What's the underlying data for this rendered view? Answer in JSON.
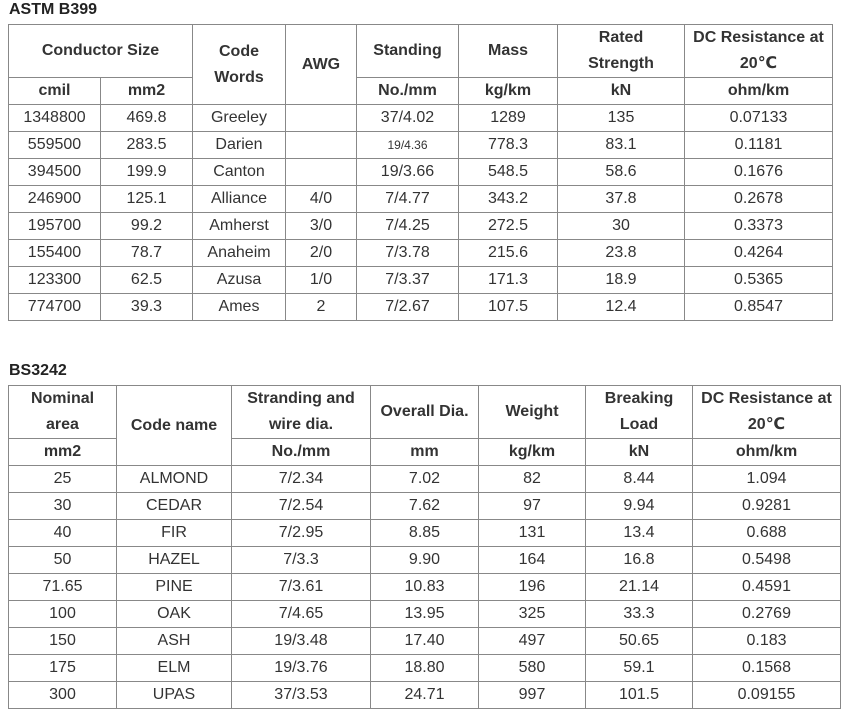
{
  "astm": {
    "title": "ASTM B399",
    "headers": {
      "conductor_size": "Conductor Size",
      "code_words": "Code Words",
      "awg": "AWG",
      "standing": "Standing",
      "mass": "Mass",
      "rated_strength": "Rated Strength",
      "dc_resistance": "DC Resistance at 20℃"
    },
    "units": {
      "cmil": "cmil",
      "mm2": "mm2",
      "standing": "No./mm",
      "mass": "kg/km",
      "rated_strength": "kN",
      "dc_resistance": "ohm/km"
    },
    "rows": [
      {
        "cmil": "1348800",
        "mm2": "469.8",
        "code": "Greeley",
        "awg": "",
        "standing": "37/4.02",
        "mass": "1289",
        "strength": "135",
        "resistance": "0.07133"
      },
      {
        "cmil": "559500",
        "mm2": "283.5",
        "code": "Darien",
        "awg": "",
        "standing": "19/4.36",
        "mass": "778.3",
        "strength": "83.1",
        "resistance": "0.1181"
      },
      {
        "cmil": "394500",
        "mm2": "199.9",
        "code": "Canton",
        "awg": "",
        "standing": "19/3.66",
        "mass": "548.5",
        "strength": "58.6",
        "resistance": "0.1676"
      },
      {
        "cmil": "246900",
        "mm2": "125.1",
        "code": "Alliance",
        "awg": "4/0",
        "standing": "7/4.77",
        "mass": "343.2",
        "strength": "37.8",
        "resistance": "0.2678"
      },
      {
        "cmil": "195700",
        "mm2": "99.2",
        "code": "Amherst",
        "awg": "3/0",
        "standing": "7/4.25",
        "mass": "272.5",
        "strength": "30",
        "resistance": "0.3373"
      },
      {
        "cmil": "155400",
        "mm2": "78.7",
        "code": "Anaheim",
        "awg": "2/0",
        "standing": "7/3.78",
        "mass": "215.6",
        "strength": "23.8",
        "resistance": "0.4264"
      },
      {
        "cmil": "123300",
        "mm2": "62.5",
        "code": "Azusa",
        "awg": "1/0",
        "standing": "7/3.37",
        "mass": "171.3",
        "strength": "18.9",
        "resistance": "0.5365"
      },
      {
        "cmil": "774700",
        "mm2": "39.3",
        "code": "Ames",
        "awg": "2",
        "standing": "7/2.67",
        "mass": "107.5",
        "strength": "12.4",
        "resistance": "0.8547"
      }
    ]
  },
  "bs": {
    "title": "BS3242",
    "headers": {
      "nominal_area": "Nominal area",
      "code_name": "Code name",
      "stranding": "Stranding and wire dia.",
      "overall_dia": "Overall Dia.",
      "weight": "Weight",
      "breaking_load": "Breaking Load",
      "dc_resistance": "DC Resistance at 20℃"
    },
    "units": {
      "nominal_area": "mm2",
      "stranding": "No./mm",
      "overall_dia": "mm",
      "weight": "kg/km",
      "breaking_load": "kN",
      "dc_resistance": "ohm/km"
    },
    "rows": [
      {
        "area": "25",
        "code": "ALMOND",
        "stranding": "7/2.34",
        "dia": "7.02",
        "weight": "82",
        "load": "8.44",
        "resistance": "1.094"
      },
      {
        "area": "30",
        "code": "CEDAR",
        "stranding": "7/2.54",
        "dia": "7.62",
        "weight": "97",
        "load": "9.94",
        "resistance": "0.9281"
      },
      {
        "area": "40",
        "code": "FIR",
        "stranding": "7/2.95",
        "dia": "8.85",
        "weight": "131",
        "load": "13.4",
        "resistance": "0.688"
      },
      {
        "area": "50",
        "code": "HAZEL",
        "stranding": "7/3.3",
        "dia": "9.90",
        "weight": "164",
        "load": "16.8",
        "resistance": "0.5498"
      },
      {
        "area": "71.65",
        "code": "PINE",
        "stranding": "7/3.61",
        "dia": "10.83",
        "weight": "196",
        "load": "21.14",
        "resistance": "0.4591"
      },
      {
        "area": "100",
        "code": "OAK",
        "stranding": "7/4.65",
        "dia": "13.95",
        "weight": "325",
        "load": "33.3",
        "resistance": "0.2769"
      },
      {
        "area": "150",
        "code": "ASH",
        "stranding": "19/3.48",
        "dia": "17.40",
        "weight": "497",
        "load": "50.65",
        "resistance": "0.183"
      },
      {
        "area": "175",
        "code": "ELM",
        "stranding": "19/3.76",
        "dia": "18.80",
        "weight": "580",
        "load": "59.1",
        "resistance": "0.1568"
      },
      {
        "area": "300",
        "code": "UPAS",
        "stranding": "37/3.53",
        "dia": "24.71",
        "weight": "997",
        "load": "101.5",
        "resistance": "0.09155"
      }
    ]
  }
}
